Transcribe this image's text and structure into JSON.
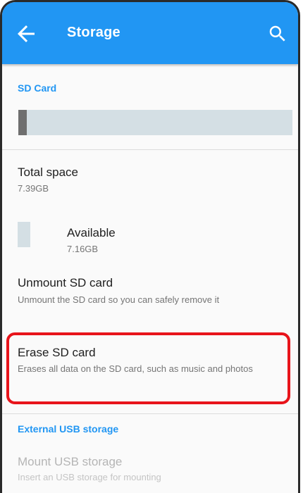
{
  "appbar": {
    "title": "Storage",
    "back_icon": "arrow-back-icon",
    "search_icon": "search-icon",
    "color": "#2196f3"
  },
  "sd_card": {
    "header": "SD Card",
    "used_fraction": 0.031,
    "total_space_label": "Total space",
    "total_space_value": "7.39GB",
    "available_label": "Available",
    "available_value": "7.16GB"
  },
  "actions": {
    "unmount_title": "Unmount SD card",
    "unmount_sub": "Unmount the SD card so you can safely remove it",
    "erase_title": "Erase SD card",
    "erase_sub": "Erases all data on the SD card, such as music and photos",
    "highlight_color": "#e8141b"
  },
  "usb": {
    "header": "External USB storage",
    "mount_title": "Mount USB storage",
    "mount_sub": "Insert an USB storage for mounting"
  }
}
